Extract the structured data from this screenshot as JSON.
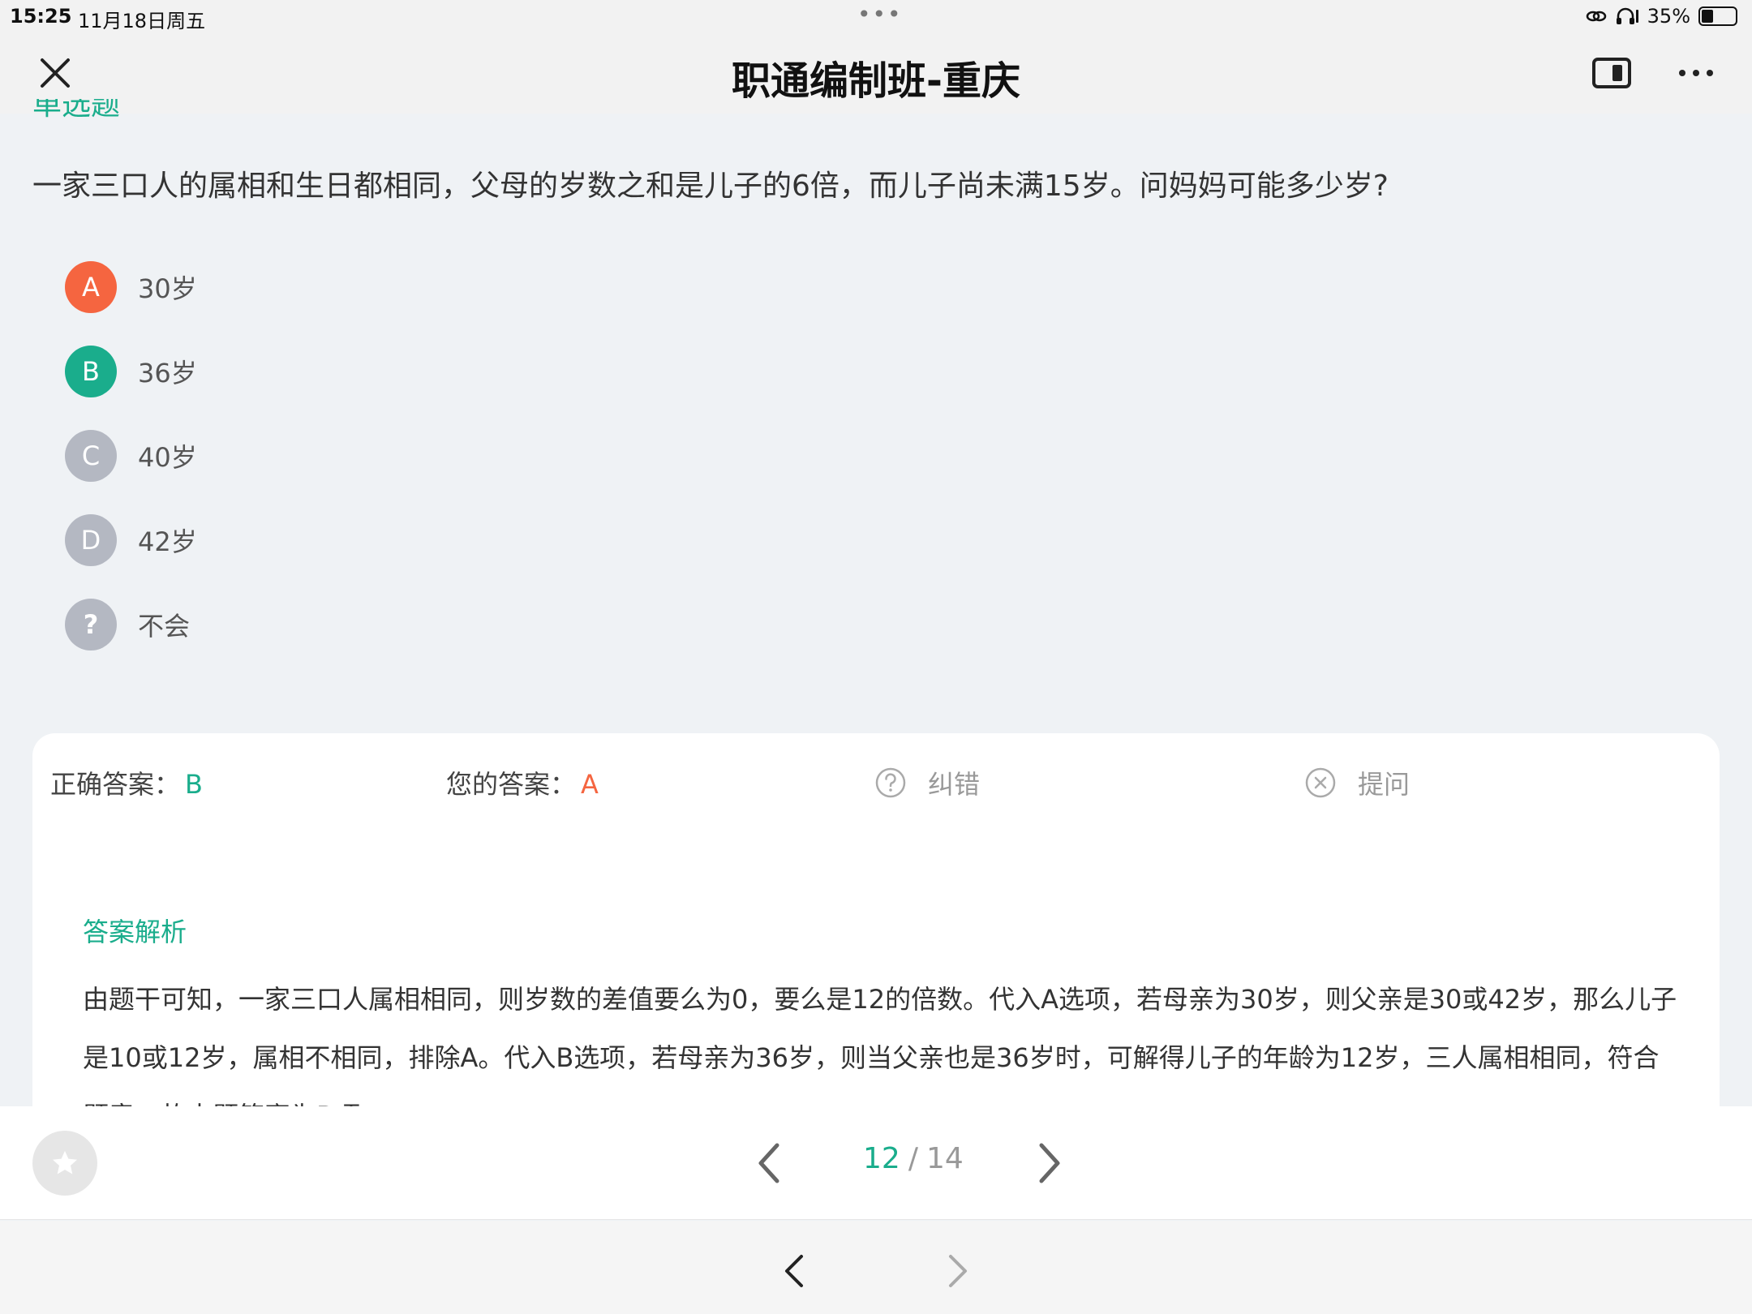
{
  "status": {
    "time": "15:25",
    "date": "11月18日周五",
    "battery_text": "35%",
    "battery_level": 0.35,
    "icons": [
      "link-icon",
      "headphones-icon",
      "battery-icon"
    ]
  },
  "nav": {
    "title": "职通编制班-重庆",
    "icons": [
      "close-icon",
      "split-view-icon",
      "more-icon"
    ]
  },
  "question": {
    "type_label": "单选题",
    "text": "一家三口人的属相和生日都相同，父母的岁数之和是儿子的6倍，而儿子尚未满15岁。问妈妈可能多少岁?",
    "options": [
      {
        "letter": "A",
        "text": "30岁",
        "color": "#f56540"
      },
      {
        "letter": "B",
        "text": "36岁",
        "color": "#1aad8c"
      },
      {
        "letter": "C",
        "text": "40岁",
        "color": "#b4b8c2"
      },
      {
        "letter": "D",
        "text": "42岁",
        "color": "#b4b8c2"
      },
      {
        "letter": "?",
        "text": "不会",
        "color": "#b4b8c2"
      }
    ]
  },
  "answer": {
    "correct_label": "正确答案：",
    "correct_value": "B",
    "yours_label": "您的答案：",
    "yours_value": "A",
    "fix_label": "纠错",
    "ask_label": "提问"
  },
  "analysis": {
    "title": "答案解析",
    "body": "由题干可知，一家三口人属相相同，则岁数的差值要么为0，要么是12的倍数。代入A选项，若母亲为30岁，则父亲是30或42岁，那么儿子是10或12岁，属相不相同，排除A。代入B选项，若母亲为36岁，则当父亲也是36岁时，可解得儿子的年龄为12岁，三人属相相同，符合题意。故本题答案为B项。"
  },
  "pager": {
    "current": "12",
    "separator": "/",
    "total": "14"
  },
  "colors": {
    "accent": "#1aad8c",
    "wrong": "#f56540",
    "inactive": "#b4b8c2"
  }
}
